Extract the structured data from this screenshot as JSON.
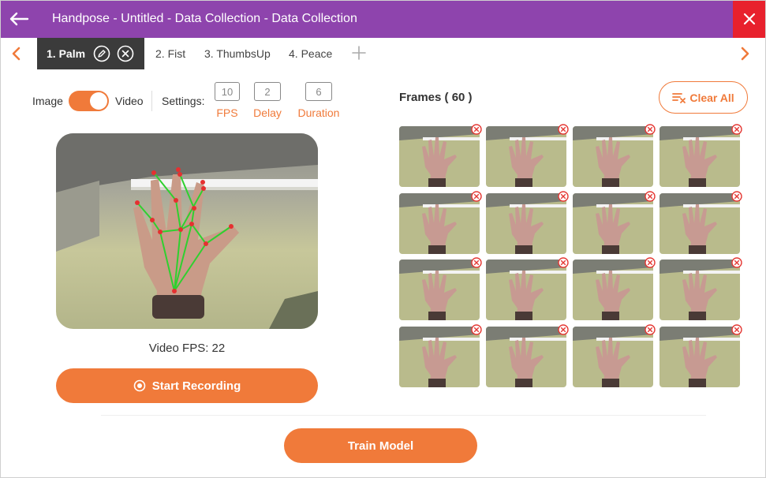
{
  "window": {
    "title": "Handpose - Untitled - Data Collection - Data Collection",
    "title_color": "#8e44ad",
    "close_color": "#e8212d"
  },
  "tabs": [
    {
      "label": "1. Palm",
      "active": true
    },
    {
      "label": "2. Fist",
      "active": false
    },
    {
      "label": "3. ThumbsUp",
      "active": false
    },
    {
      "label": "4. Peace",
      "active": false
    }
  ],
  "mode": {
    "left_label": "Image",
    "right_label": "Video",
    "value": "Video"
  },
  "settings": {
    "label": "Settings:",
    "fps": {
      "value": "10",
      "label": "FPS"
    },
    "delay": {
      "value": "2",
      "label": "Delay"
    },
    "duration": {
      "value": "6",
      "label": "Duration"
    }
  },
  "camera": {
    "fps_text": "Video FPS: 22"
  },
  "record_button": {
    "label": "Start Recording"
  },
  "frames": {
    "title": "Frames ( 60 )",
    "count_visible": 16,
    "clear_label": "Clear All"
  },
  "train_button": {
    "label": "Train Model"
  },
  "accent_color": "#f07a3a"
}
